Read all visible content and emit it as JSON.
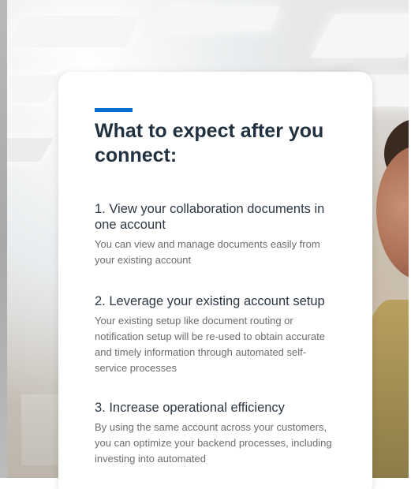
{
  "card": {
    "title": "What to expect after you connect:",
    "accent_color": "#0a6ed1",
    "items": [
      {
        "heading": "1. View your collaboration documents in one account",
        "description": "You can view and manage documents easily from your existing account"
      },
      {
        "heading": "2. Leverage your existing account setup",
        "description": "Your existing setup like document routing or notification setup will be re-used to obtain accurate and timely information through automated self-service processes"
      },
      {
        "heading": "3. Increase operational efficiency",
        "description": "By using the same account across your customers, you can optimize your backend processes, including investing into automated"
      }
    ]
  }
}
